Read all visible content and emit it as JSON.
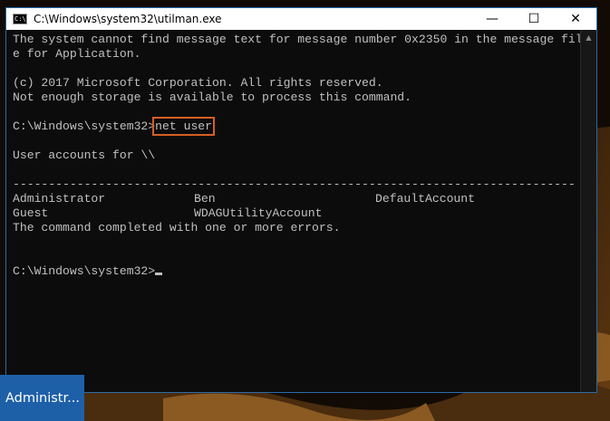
{
  "window": {
    "title": "C:\\Windows\\system32\\utilman.exe",
    "icon_glyph": "C:\\",
    "controls": {
      "minimize": "—",
      "maximize": "☐",
      "close": "✕"
    }
  },
  "console": {
    "error_line_1": "The system cannot find message text for message number 0x2350 in the message fil",
    "error_line_2": "e for Application.",
    "copyright": "(c) 2017 Microsoft Corporation. All rights reserved.",
    "storage_error": "Not enough storage is available to process this command.",
    "prompt_1": "C:\\Windows\\system32>",
    "command": "net user",
    "accounts_header": "User accounts for \\\\",
    "separator": "-------------------------------------------------------------------------------",
    "accounts": [
      [
        "Administrator",
        "Ben",
        "DefaultAccount"
      ],
      [
        "Guest",
        "WDAGUtilityAccount",
        ""
      ]
    ],
    "completion": "The command completed with one or more errors.",
    "prompt_2": "C:\\Windows\\system32>"
  },
  "taskbar": {
    "active_user_button": "Administr..."
  },
  "colors": {
    "console_bg": "#0c0c0c",
    "console_text": "#c0c0c0",
    "highlight_box": "#d55f24",
    "window_border": "#2c6aa8",
    "taskbar_button": "#1e60a8"
  }
}
